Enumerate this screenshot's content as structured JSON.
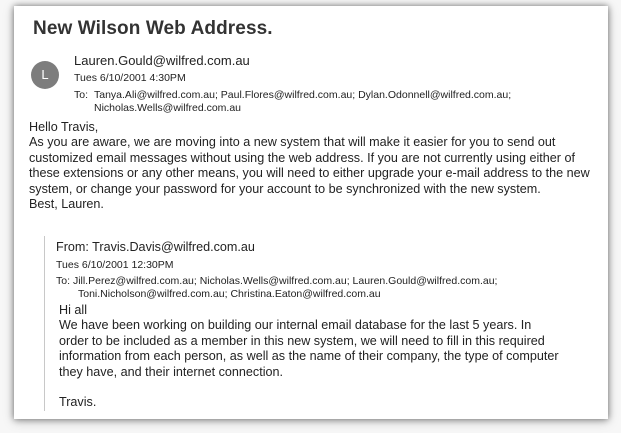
{
  "email": {
    "subject": "New Wilson Web Address.",
    "avatar_initial": "L",
    "from": "Lauren.Gould@wilfred.com.au",
    "date": "Tues 6/10/2001 4:30PM",
    "to_label": "To:",
    "to_line1": "Tanya.Ali@wilfred.com.au; Paul.Flores@wilfred.com.au; Dylan.Odonnell@wilfred.com.au;",
    "to_line2": "Nicholas.Wells@wilfred.com.au",
    "greeting": "Hello Travis,",
    "body": "As you are aware, we are moving into a new system that will make it easier for you to send out customized email messages without using the web address. If you are not currently using either of these extensions or any other means, you will need to either upgrade your e-mail address to the new system, or change your password for your account to be synchronized with the new system.",
    "signoff": "Best, Lauren."
  },
  "quoted": {
    "from": "From: Travis.Davis@wilfred.com.au",
    "date": "Tues 6/10/2001 12:30PM",
    "to_label": "To:",
    "to_line1": "Jill.Perez@wilfred.com.au; Nicholas.Wells@wilfred.com.au; Lauren.Gould@wilfred.com.au;",
    "to_line2": "Toni.Nicholson@wilfred.com.au; Christina.Eaton@wilfred.com.au",
    "greeting": "Hi all",
    "body": "We have been working on building our internal email database for the last 5 years. In order to be included as a member in this new system, we will need to fill in this required information from each person, as well as the name of their company, the type of computer they have, and their internet connection.",
    "signoff": "Travis."
  },
  "colors": {
    "avatar_bg": "#7d7d7d",
    "quote_border": "#c8c8c8",
    "text": "#222222"
  }
}
